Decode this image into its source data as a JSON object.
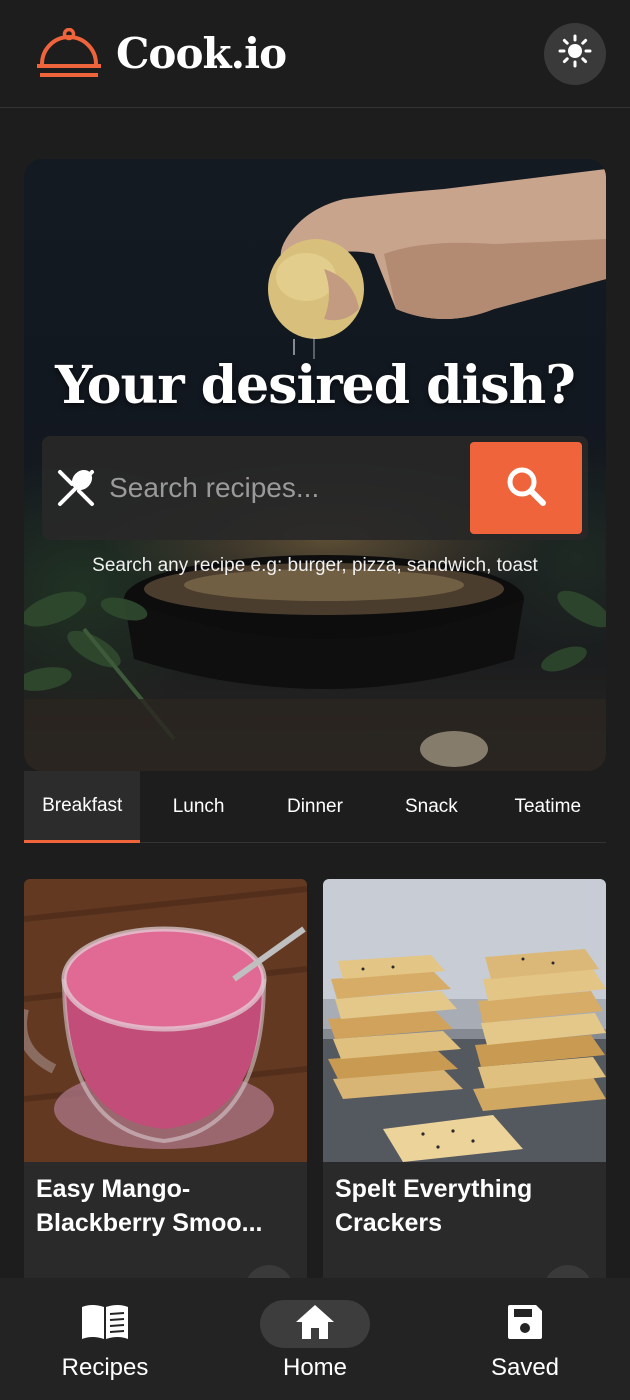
{
  "header": {
    "brand_name": "Cook.io",
    "logo_icon": "cloche-icon",
    "theme_toggle_icon": "sun-icon",
    "accent_color": "#f0643c"
  },
  "hero": {
    "title": "Your desired dish?",
    "search": {
      "left_icon": "fork-spoon-icon",
      "placeholder": "Search recipes...",
      "value": "",
      "button_icon": "search-icon"
    },
    "hint": "Search any recipe e.g: burger, pizza, sandwich, toast"
  },
  "tabs": [
    {
      "label": "Breakfast",
      "active": true
    },
    {
      "label": "Lunch",
      "active": false
    },
    {
      "label": "Dinner",
      "active": false
    },
    {
      "label": "Snack",
      "active": false
    },
    {
      "label": "Teatime",
      "active": false
    }
  ],
  "cards": [
    {
      "title": "Easy Mango-Blackberry Smoo..."
    },
    {
      "title": "Spelt Everything Crackers"
    }
  ],
  "bottom_nav": [
    {
      "label": "Recipes",
      "icon": "book-icon",
      "active": false
    },
    {
      "label": "Home",
      "icon": "home-icon",
      "active": true
    },
    {
      "label": "Saved",
      "icon": "floppy-disk-icon",
      "active": false
    }
  ]
}
